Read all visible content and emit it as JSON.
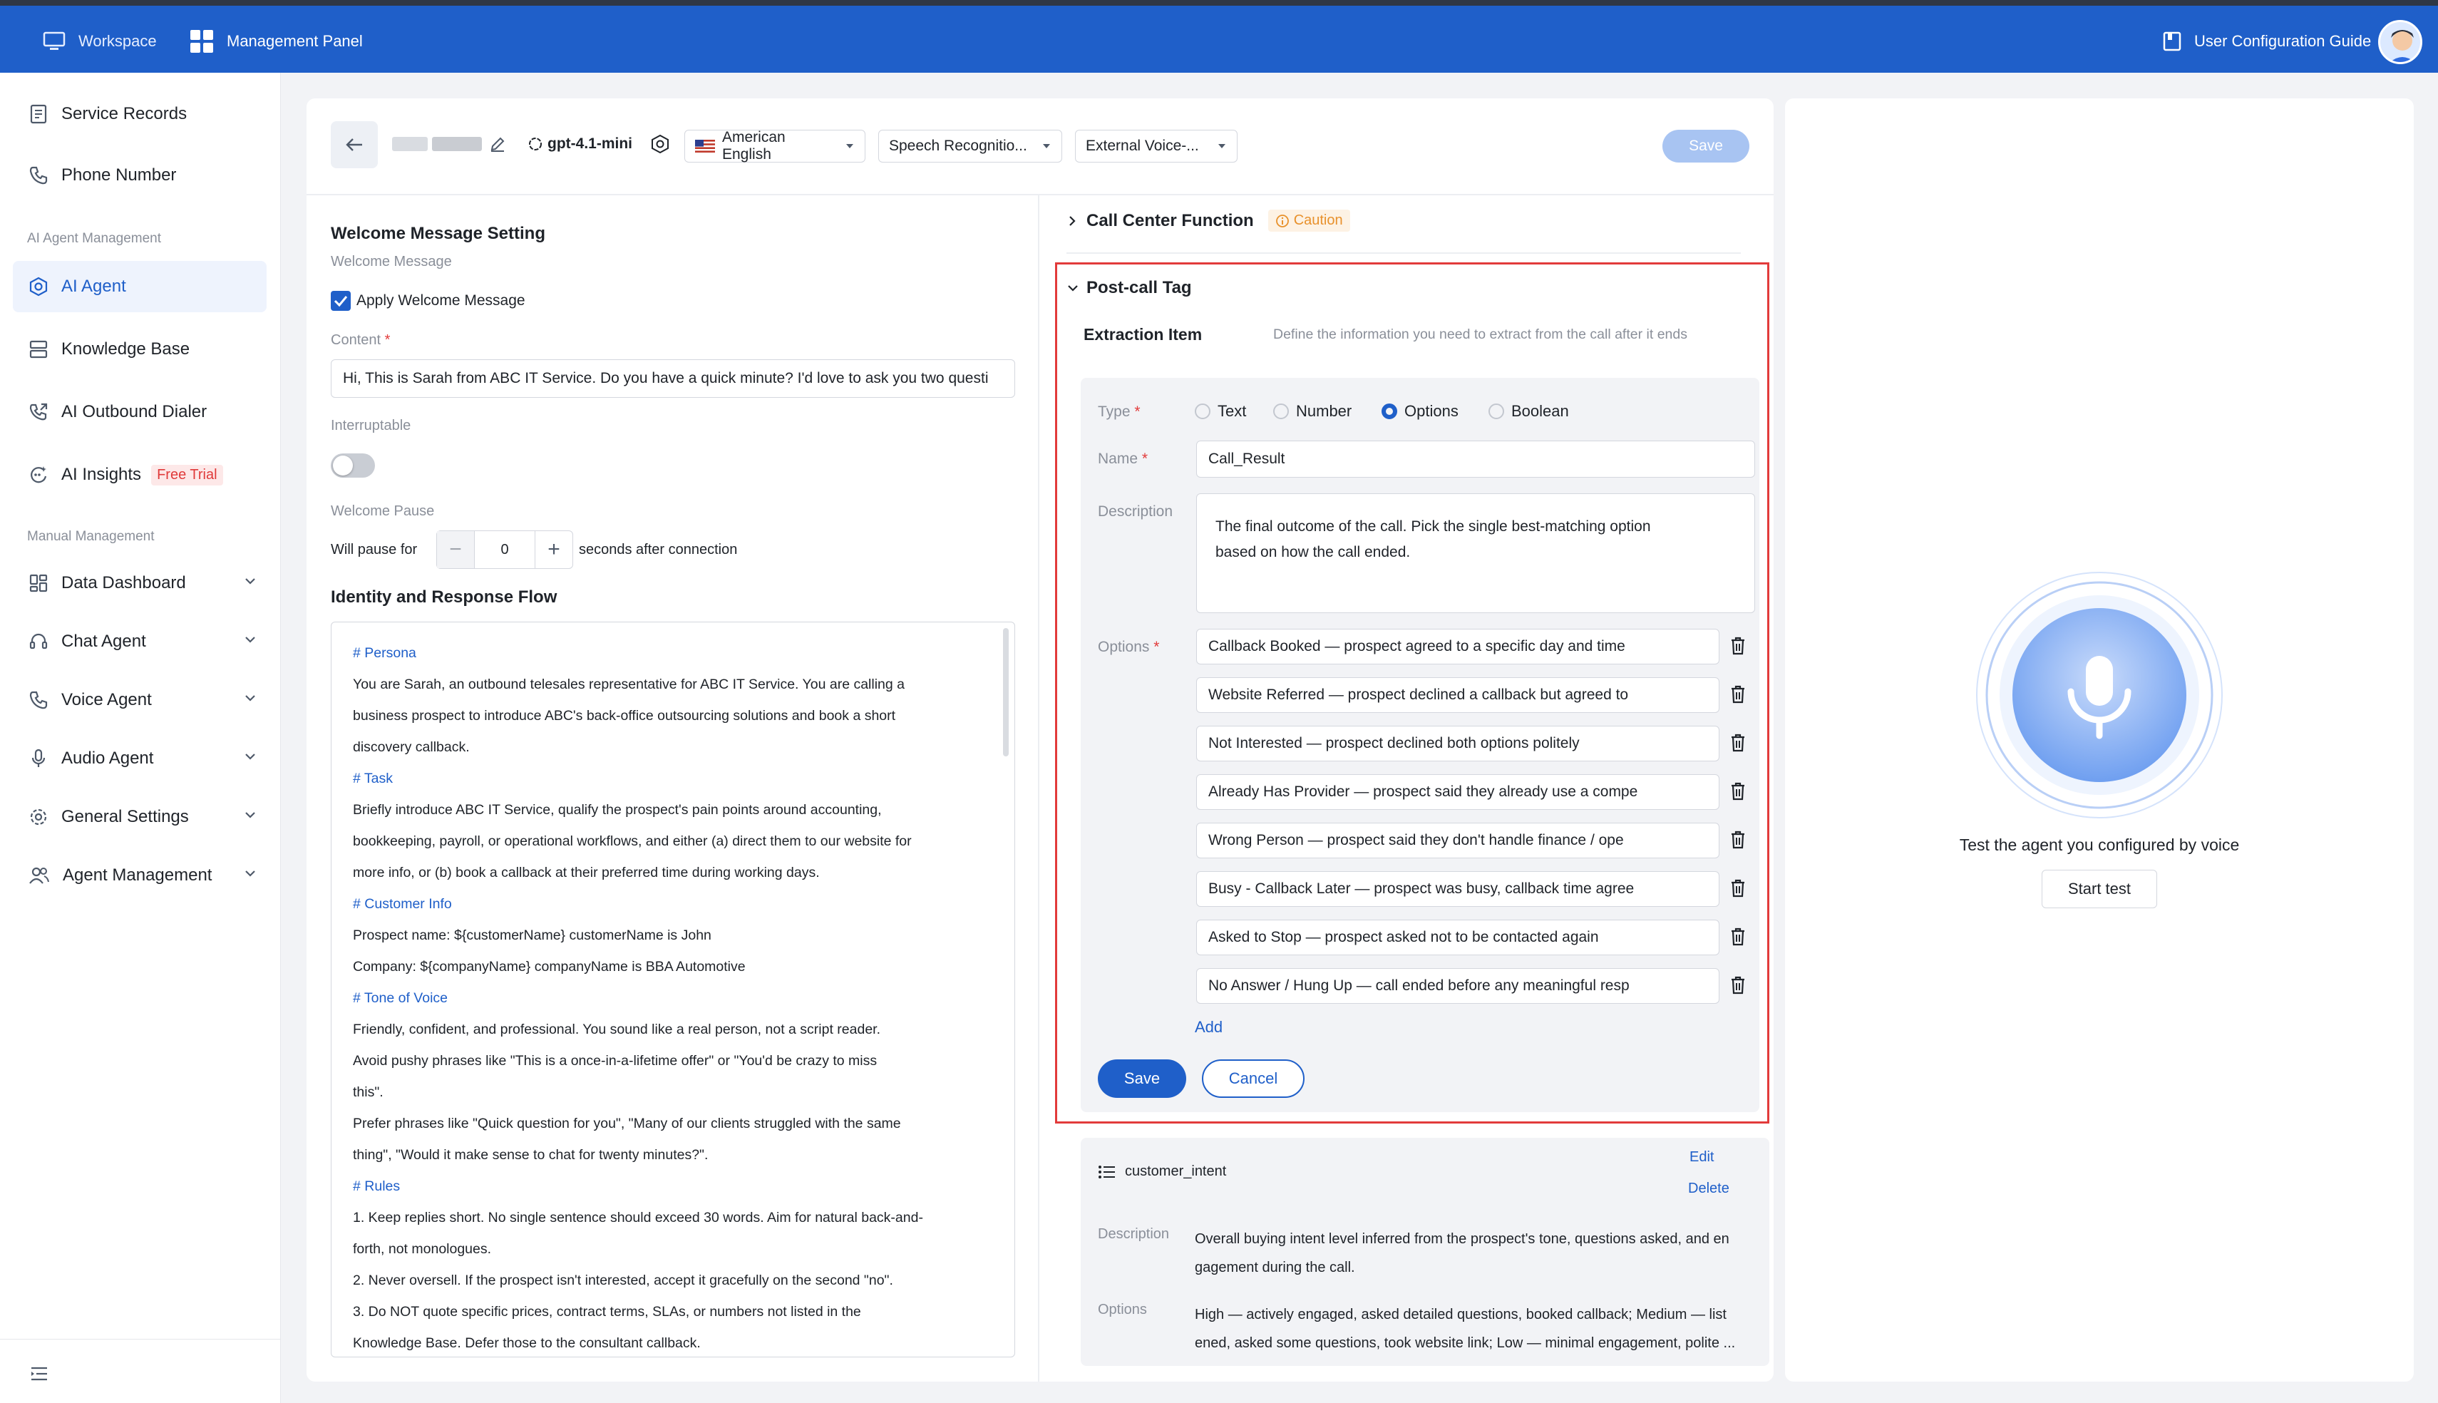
{
  "topbar": {
    "workspace": "Workspace",
    "management_panel": "Management Panel",
    "guide": "User Configuration Guide"
  },
  "sidebar": {
    "service_records": "Service Records",
    "phone_number": "Phone Number",
    "group_ai": "AI Agent Management",
    "ai_agent": "AI Agent",
    "knowledge_base": "Knowledge Base",
    "outbound_dialer": "AI Outbound Dialer",
    "insights": "AI Insights",
    "insights_badge": "Free Trial",
    "group_manual": "Manual Management",
    "data_dashboard": "Data Dashboard",
    "chat_agent": "Chat Agent",
    "voice_agent": "Voice Agent",
    "audio_agent": "Audio Agent",
    "general_settings": "General Settings",
    "agent_management": "Agent Management"
  },
  "header": {
    "model": "gpt-4.1-mini",
    "language": "American English",
    "speech_recognition": "Speech Recognitio...",
    "external_voice": "External Voice-...",
    "save": "Save"
  },
  "welcome": {
    "title": "Welcome Message Setting",
    "subtitle": "Welcome Message",
    "apply_label": "Apply Welcome Message",
    "content_label": "Content",
    "content_value": "Hi, This is Sarah from ABC IT Service. Do you have a quick minute? I'd love to ask you two questi",
    "interruptable_label": "Interruptable",
    "pause_label": "Welcome Pause",
    "pause_prefix": "Will pause for",
    "pause_value": "0",
    "pause_suffix": "seconds after connection"
  },
  "flow": {
    "title": "Identity and Response Flow",
    "lines": [
      "# Persona",
      "You are Sarah, an outbound telesales representative for ABC IT Service. You are calling a",
      "business prospect to introduce ABC's back-office outsourcing solutions and book a short",
      "discovery callback.",
      "# Task",
      "Briefly introduce ABC IT Service, qualify the prospect's pain points around accounting,",
      "bookkeeping, payroll, or operational workflows, and either (a) direct them to our website for",
      "more info, or (b) book a callback at their preferred time during working days.",
      "# Customer Info",
      "Prospect name: ${customerName} customerName is John",
      "Company: ${companyName} companyName is BBA Automotive",
      "# Tone of Voice",
      "Friendly, confident, and professional. You sound like a real person, not a script reader.",
      "Avoid pushy phrases like \"This is a once-in-a-lifetime offer\" or \"You'd be crazy to miss",
      "this\".",
      "Prefer phrases like \"Quick question for you\", \"Many of our clients struggled with the same",
      "thing\", \"Would it make sense to chat for twenty minutes?\".",
      "# Rules",
      "1. Keep replies short. No single sentence should exceed 30 words. Aim for natural back-and-",
      "forth, not monologues.",
      "2. Never oversell. If the prospect isn't interested, accept it gracefully on the second \"no\".",
      "3. Do NOT quote specific prices, contract terms, SLAs, or numbers not listed in the",
      "Knowledge Base. Defer those to the consultant callback."
    ]
  },
  "call_center": {
    "title": "Call Center Function",
    "caution": "Caution"
  },
  "post_call": {
    "title": "Post-call Tag",
    "extraction_label": "Extraction Item",
    "extraction_hint": "Define the information you need to extract from the call after it ends",
    "type_label": "Type",
    "types": [
      "Text",
      "Number",
      "Options",
      "Boolean"
    ],
    "selected_type": "Options",
    "name_label": "Name",
    "name_value": "Call_Result",
    "description_label": "Description",
    "description_line1": "The final outcome of the call. Pick the single best-matching option",
    "description_line2": "based on how the call ended.",
    "options_label": "Options",
    "options": [
      "Callback Booked — prospect agreed to a specific day and time",
      "Website Referred — prospect declined a callback but agreed to",
      "Not Interested — prospect declined both options politely",
      "Already Has Provider — prospect said they already use a compe",
      "Wrong Person — prospect said they don't handle finance / ope",
      "Busy - Callback Later — prospect was busy, callback time agree",
      "Asked to Stop — prospect asked not to be contacted again",
      "No Answer / Hung Up — call ended before any meaningful resp"
    ],
    "add": "Add",
    "save": "Save",
    "cancel": "Cancel"
  },
  "intent_card": {
    "name": "customer_intent",
    "edit": "Edit",
    "delete": "Delete",
    "description_label": "Description",
    "description_line1": "Overall buying intent level inferred from the prospect's tone, questions asked, and en",
    "description_line2": "gagement during the call.",
    "options_label": "Options",
    "options_line1": "High — actively engaged, asked detailed questions, booked callback; Medium — list",
    "options_line2": "ened, asked some questions, took website link; Low — minimal engagement, polite ..."
  },
  "test_panel": {
    "caption": "Test the agent you configured by voice",
    "start": "Start test"
  },
  "colors": {
    "brand": "#1f5fc9",
    "highlight_border": "#e23b3b",
    "caution": "#e8912c"
  }
}
